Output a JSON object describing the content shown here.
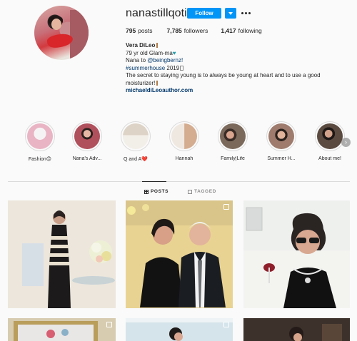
{
  "profile": {
    "username": "nanastillqotit",
    "follow_label": "Follow",
    "stats": [
      {
        "count": "795",
        "label": "posts"
      },
      {
        "count": "7,785",
        "label": "followers"
      },
      {
        "count": "1,417",
        "label": "following"
      }
    ],
    "bio": {
      "name": "Vera DiLeo",
      "line1": "79 yr old Glam-ma",
      "line2_prefix": "Nana to ",
      "line2_mention": "@beingbernz!",
      "hashtag": "#summerhouse",
      "hashtag_suffix": " 2019",
      "quote": "The secret to staying young is to always be young at heart and to use a good moisturizer!",
      "website": "michaeldiLeoauthor.com"
    }
  },
  "highlights": [
    {
      "label": "Fashion😊",
      "color": "#e9b4c4"
    },
    {
      "label": "Nana's Adv...",
      "color": "#b0505c"
    },
    {
      "label": "Q and A❤️",
      "color": "#e6ded3"
    },
    {
      "label": "Hannah",
      "color": "#d9b79a"
    },
    {
      "label": "Family|Life",
      "color": "#7b6a5c"
    },
    {
      "label": "Summer H...",
      "color": "#9e7b6d"
    },
    {
      "label": "About me!",
      "color": "#5a4a40"
    }
  ],
  "tabs": {
    "posts": "POSTS",
    "tagged": "TAGGED"
  },
  "colors": {
    "accent": "#0095f6",
    "link": "#00376b",
    "text": "#262626",
    "muted": "#8e8e8e"
  }
}
